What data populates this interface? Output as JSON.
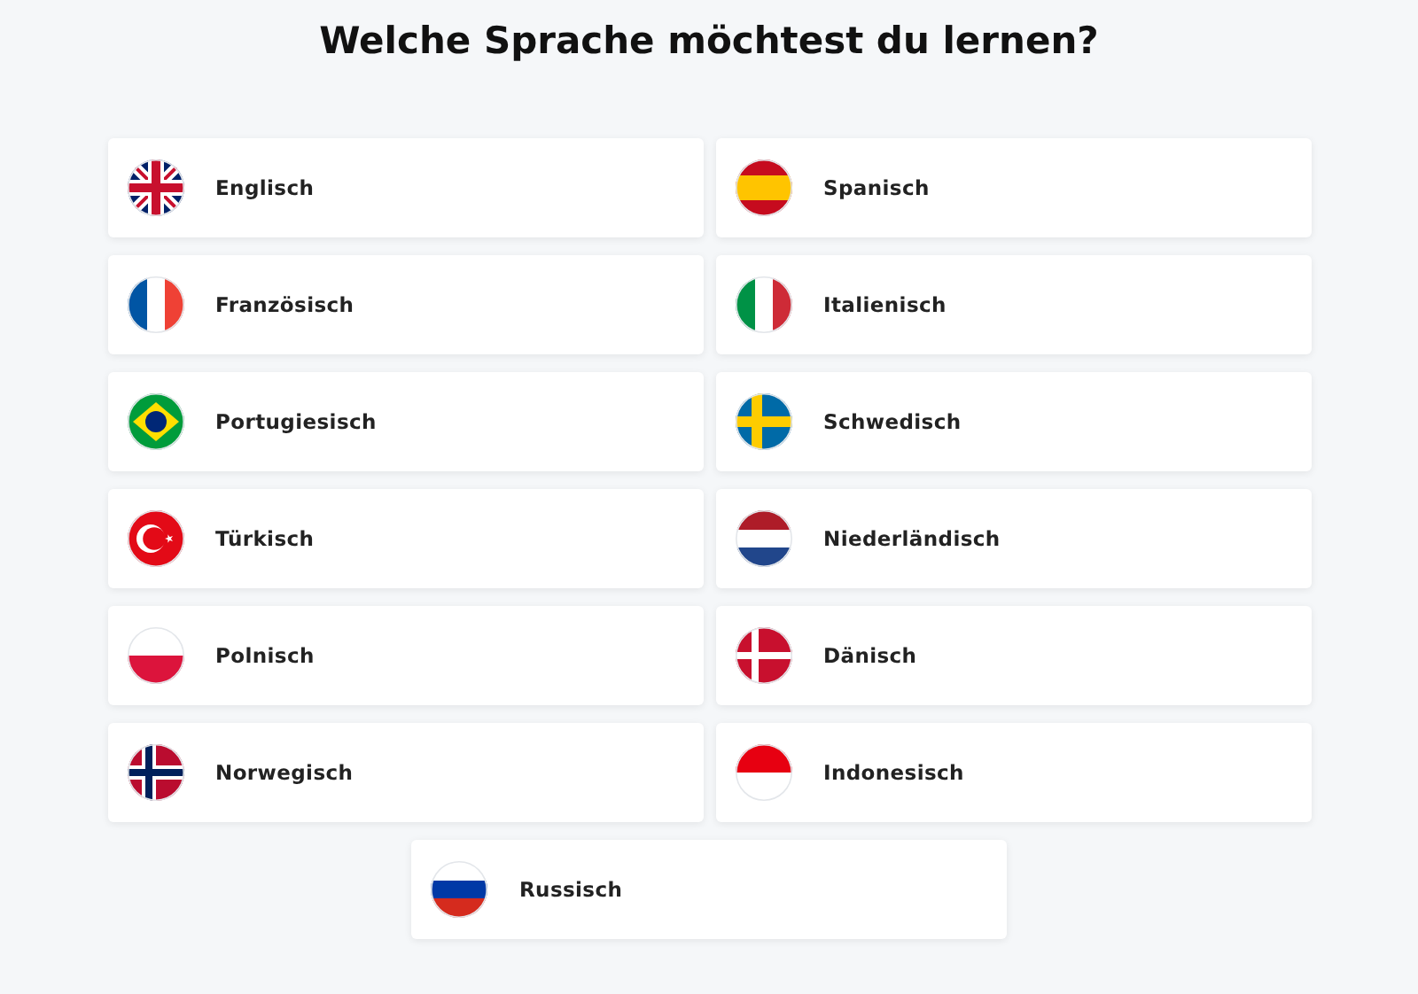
{
  "title": "Welche Sprache möchtest du lernen?",
  "languages": [
    {
      "label": "Englisch"
    },
    {
      "label": "Spanisch"
    },
    {
      "label": "Französisch"
    },
    {
      "label": "Italienisch"
    },
    {
      "label": "Portugiesisch"
    },
    {
      "label": "Schwedisch"
    },
    {
      "label": "Türkisch"
    },
    {
      "label": "Niederländisch"
    },
    {
      "label": "Polnisch"
    },
    {
      "label": "Dänisch"
    },
    {
      "label": "Norwegisch"
    },
    {
      "label": "Indonesisch"
    },
    {
      "label": "Russisch"
    }
  ]
}
